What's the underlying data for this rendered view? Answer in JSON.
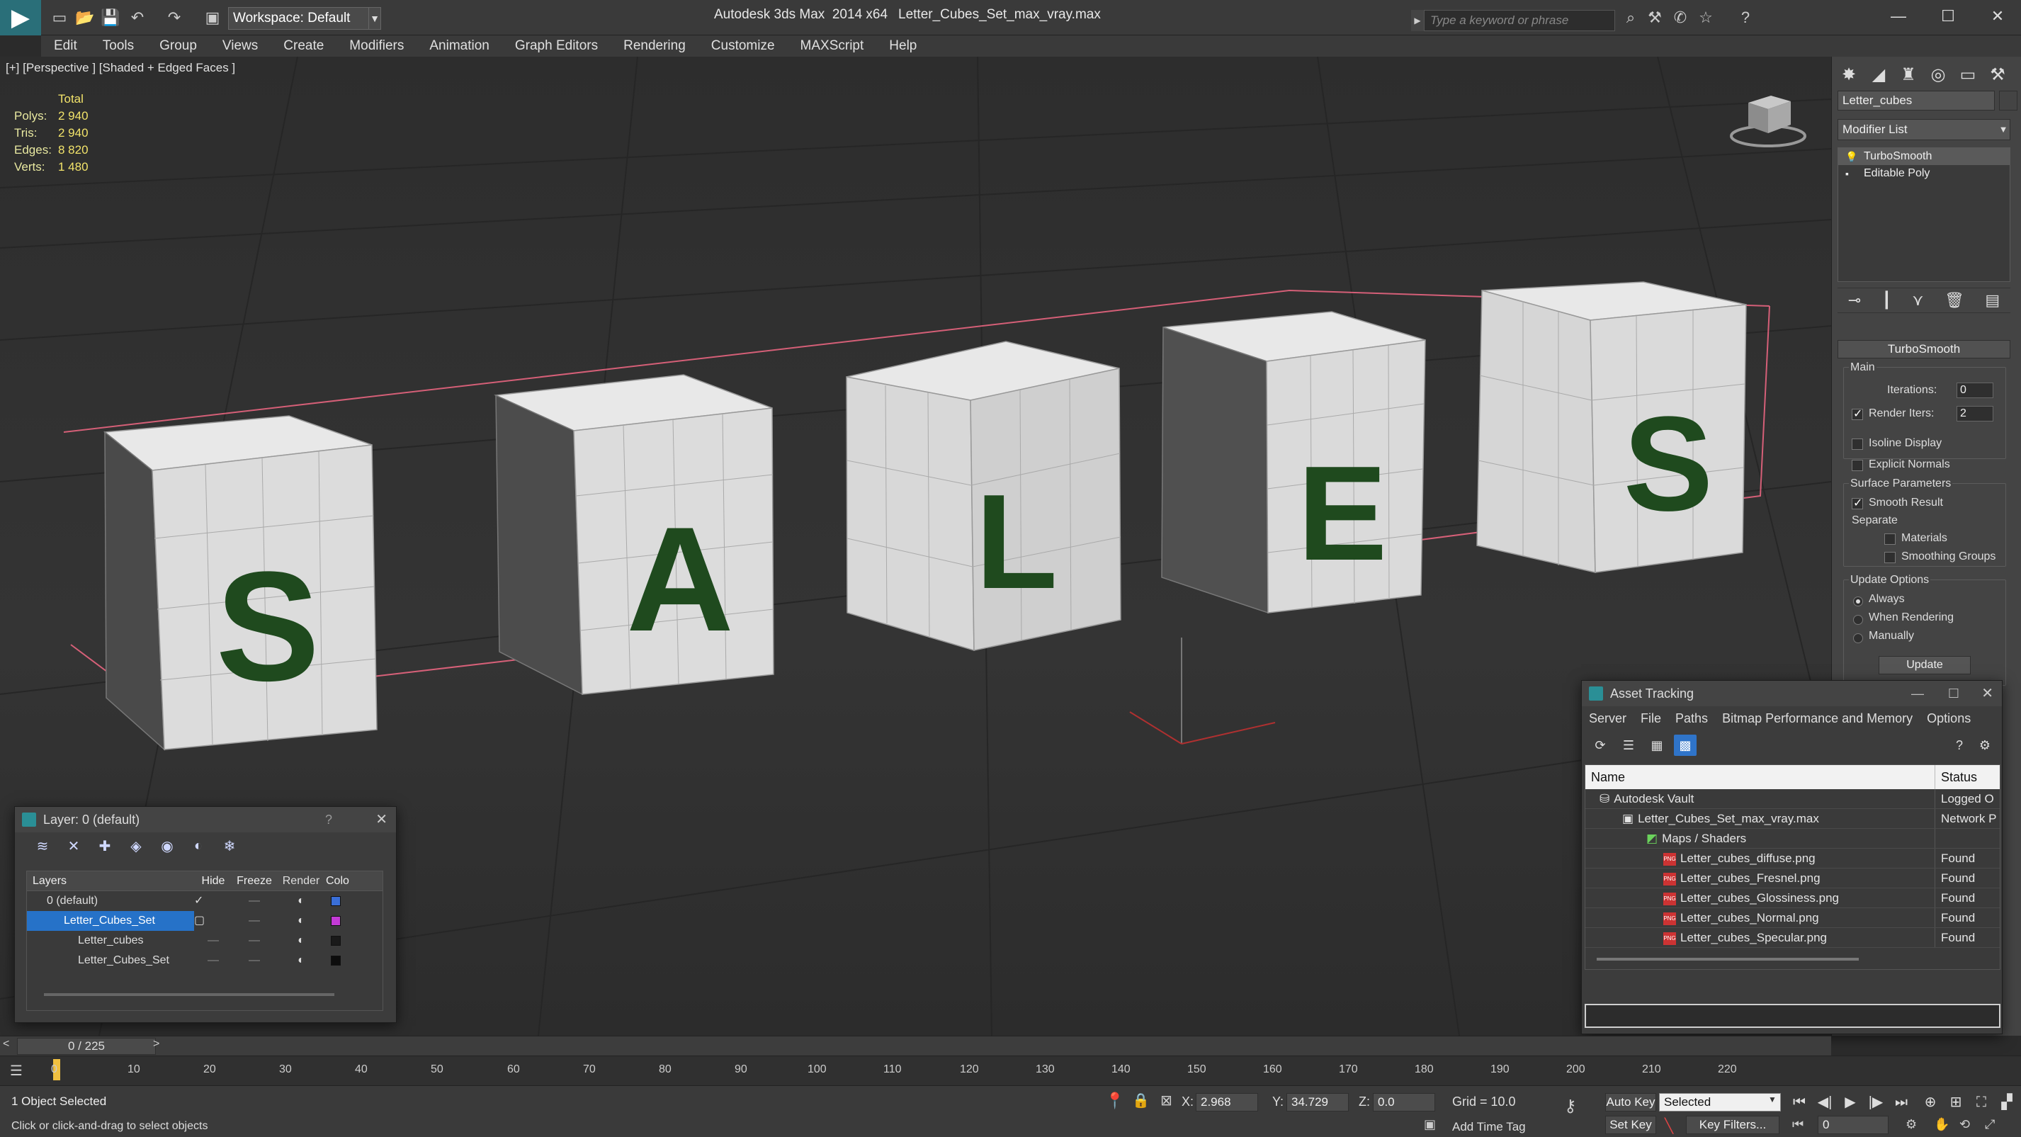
{
  "titlebar": {
    "app_title": "Autodesk 3ds Max  2014 x64",
    "file_title": "Letter_Cubes_Set_max_vray.max",
    "workspace": "Workspace: Default",
    "search_placeholder": "Type a keyword or phrase"
  },
  "menu": [
    "Edit",
    "Tools",
    "Group",
    "Views",
    "Create",
    "Modifiers",
    "Animation",
    "Graph Editors",
    "Rendering",
    "Customize",
    "MAXScript",
    "Help"
  ],
  "viewport": {
    "label": "[+] [Perspective ] [Shaded + Edged Faces ]",
    "stats": {
      "header": "Total",
      "rows": [
        {
          "k": "Polys:",
          "v": "2 940"
        },
        {
          "k": "Tris:",
          "v": "2 940"
        },
        {
          "k": "Edges:",
          "v": "8 820"
        },
        {
          "k": "Verts:",
          "v": "1 480"
        }
      ]
    },
    "cube_letters": [
      "S",
      "A",
      "L",
      "E",
      "S"
    ]
  },
  "command_panel": {
    "object_name": "Letter_cubes",
    "modifier_list": "Modifier List",
    "stack": [
      "TurboSmooth",
      "Editable Poly"
    ],
    "turbosmooth": {
      "title": "TurboSmooth",
      "main_label": "Main",
      "iterations_label": "Iterations:",
      "iterations": "0",
      "render_iters_label": "Render Iters:",
      "render_iters": "2",
      "isoline": "Isoline Display",
      "explicit_normals": "Explicit Normals",
      "surface_params": "Surface Parameters",
      "smooth_result": "Smooth Result",
      "separate": "Separate",
      "materials": "Materials",
      "smoothing_groups": "Smoothing Groups",
      "update_options": "Update Options",
      "always": "Always",
      "when_rendering": "When Rendering",
      "manually": "Manually",
      "update_btn": "Update"
    }
  },
  "layer_window": {
    "title": "Layer: 0 (default)",
    "help": "?",
    "columns": [
      "Layers",
      "Hide",
      "Freeze",
      "Render",
      "Colo"
    ],
    "rows": [
      {
        "name": "0 (default)",
        "color": "#3a6fd8"
      },
      {
        "name": "Letter_Cubes_Set",
        "color": "#c43ad6"
      },
      {
        "name": "Letter_cubes",
        "color": "#1a1a1a"
      },
      {
        "name": "Letter_Cubes_Set",
        "color": "#0d0d0d"
      }
    ]
  },
  "asset_tracking": {
    "title": "Asset Tracking",
    "menu": [
      "Server",
      "File",
      "Paths",
      "Bitmap Performance and Memory",
      "Options"
    ],
    "columns": [
      "Name",
      "Status"
    ],
    "rows": [
      {
        "name": "Autodesk Vault",
        "status": "Logged O"
      },
      {
        "name": "Letter_Cubes_Set_max_vray.max",
        "status": "Network P"
      },
      {
        "name": "Maps / Shaders",
        "status": ""
      },
      {
        "name": "Letter_cubes_diffuse.png",
        "status": "Found"
      },
      {
        "name": "Letter_cubes_Fresnel.png",
        "status": "Found"
      },
      {
        "name": "Letter_cubes_Glossiness.png",
        "status": "Found"
      },
      {
        "name": "Letter_cubes_Normal.png",
        "status": "Found"
      },
      {
        "name": "Letter_cubes_Specular.png",
        "status": "Found"
      }
    ]
  },
  "timeline": {
    "frame_counter": "0 / 225",
    "ticks": [
      "0",
      "10",
      "20",
      "30",
      "40",
      "50",
      "60",
      "70",
      "80",
      "90",
      "100",
      "110",
      "120",
      "130",
      "140",
      "150",
      "160",
      "170",
      "180",
      "190",
      "200",
      "210",
      "220"
    ]
  },
  "statusbar": {
    "selected": "1 Object Selected",
    "prompt": "Click or click-and-drag to select objects",
    "x_label": "X:",
    "x": "2.968",
    "y_label": "Y:",
    "y": "34.729",
    "z_label": "Z:",
    "z": "0.0",
    "grid": "Grid = 10.0",
    "add_time_tag": "Add Time Tag",
    "auto_key": "Auto Key",
    "set_key": "Set Key",
    "selected_mode": "Selected",
    "key_filters": "Key Filters...",
    "frame": "0"
  }
}
